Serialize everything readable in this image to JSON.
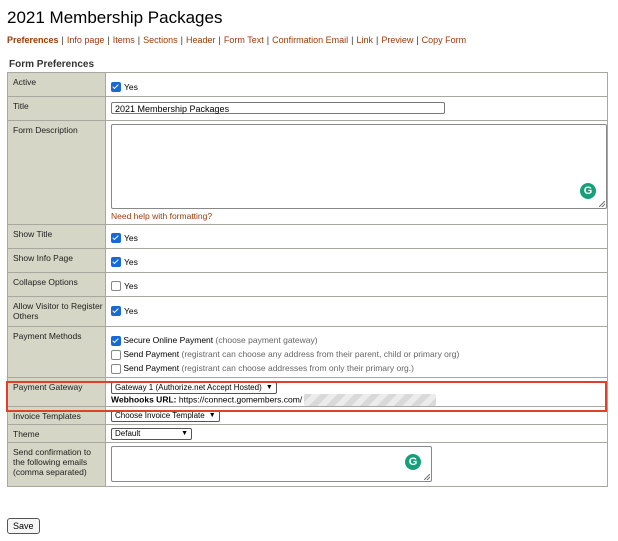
{
  "page_title": "2021 Membership Packages",
  "nav": [
    {
      "label": "Preferences",
      "active": true
    },
    {
      "label": "Info page"
    },
    {
      "label": "Items"
    },
    {
      "label": "Sections"
    },
    {
      "label": "Header"
    },
    {
      "label": "Form Text"
    },
    {
      "label": "Confirmation Email"
    },
    {
      "label": "Link"
    },
    {
      "label": "Preview"
    },
    {
      "label": "Copy Form"
    }
  ],
  "section_title": "Form Preferences",
  "rows": {
    "active": {
      "label": "Active",
      "option": "Yes",
      "checked": true
    },
    "title": {
      "label": "Title",
      "value": "2021 Membership Packages"
    },
    "description": {
      "label": "Form Description",
      "help_link": "Need help with formatting?"
    },
    "show_title": {
      "label": "Show Title",
      "option": "Yes",
      "checked": true
    },
    "show_info": {
      "label": "Show Info Page",
      "option": "Yes",
      "checked": true
    },
    "collapse": {
      "label": "Collapse Options",
      "option": "Yes",
      "checked": false
    },
    "allow_visitor": {
      "label": "Allow Visitor to Register Others",
      "option": "Yes",
      "checked": true
    },
    "payment_methods": {
      "label": "Payment Methods",
      "options": [
        {
          "name": "Secure Online Payment",
          "note": "(choose payment gateway)",
          "checked": true
        },
        {
          "name": "Send Payment",
          "note": "(registrant can choose any address from their parent, child or primary org)",
          "checked": false
        },
        {
          "name": "Send Payment",
          "note": "(registrant can choose addresses from only their primary org.)",
          "checked": false
        }
      ]
    },
    "payment_gateway": {
      "label": "Payment Gateway",
      "selected": "Gateway 1 (Authorize.net Accept Hosted)",
      "webhooks_label": "Webhooks URL:",
      "webhooks_url": "https://connect.gomembers.com/"
    },
    "invoice": {
      "label": "Invoice Templates",
      "selected": "Choose Invoice Template"
    },
    "theme": {
      "label": "Theme",
      "selected": "Default"
    },
    "emails": {
      "label": "Send confirmation to the following emails (comma separated)"
    }
  },
  "save_label": "Save",
  "icons": {
    "grammarly": "grammarly-g-icon",
    "dropdown": "chevron-down-icon"
  },
  "colors": {
    "link": "#9b3a05",
    "label_bg": "#d6d6c6",
    "highlight": "#e0402a",
    "checkbox": "#1769d8",
    "grammarly": "#15a07a"
  }
}
